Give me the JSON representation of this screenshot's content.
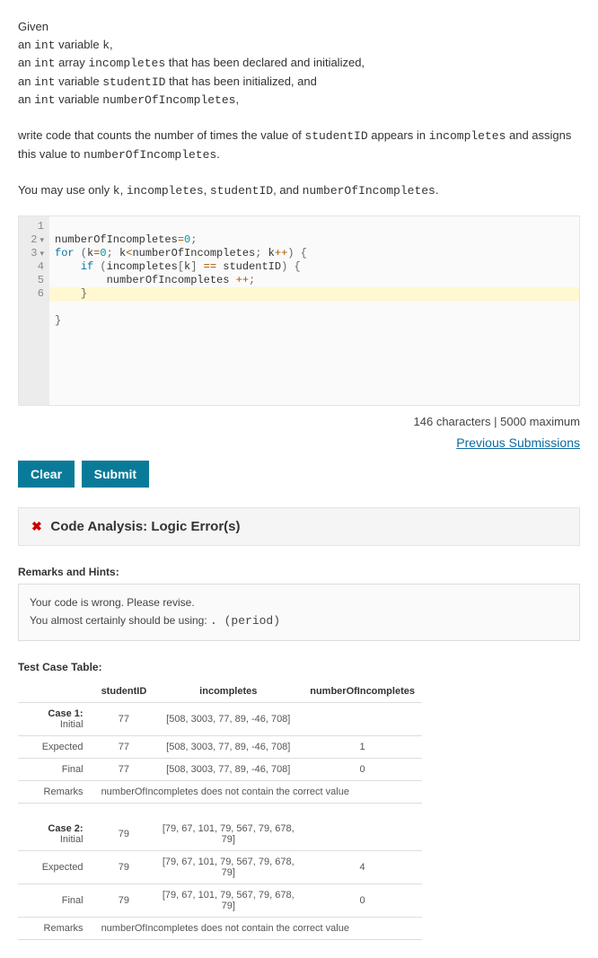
{
  "prompt": {
    "given": "Given",
    "l1a": "an ",
    "l1m": "int",
    "l1b": " variable ",
    "l1v": "k",
    "l1c": ",",
    "l2a": "an ",
    "l2m": "int",
    "l2b": " array ",
    "l2v": "incompletes",
    "l2c": " that has been declared and initialized,",
    "l3a": "an ",
    "l3m": "int",
    "l3b": " variable ",
    "l3v": "studentID",
    "l3c": " that has been initialized, and",
    "l4a": "an ",
    "l4m": "int",
    "l4b": " variable ",
    "l4v": "numberOfIncompletes",
    "l4c": ",",
    "p2a": "write code that counts the number of times the value of ",
    "p2v1": "studentID",
    "p2b": " appears in ",
    "p2v2": "incompletes",
    "p2c": " and assigns this value to ",
    "p2v3": "numberOfIncompletes",
    "p2d": ".",
    "p3a": "You may use only ",
    "p3v1": "k",
    "p3c1": ", ",
    "p3v2": "incompletes",
    "p3c2": ", ",
    "p3v3": "studentID",
    "p3c3": ", and ",
    "p3v4": "numberOfIncompletes",
    "p3d": "."
  },
  "gutter": {
    "l1": "1",
    "l2": "2",
    "l3": "3",
    "l4": "4",
    "l5": "5",
    "l6": "6"
  },
  "code": {
    "l1": "numberOfIncompletes=0;",
    "l2_for": "for",
    "l2_rest": " (k=0; k<numberOfIncompletes; k++) {",
    "l3_if": "if",
    "l3_rest": " (incompletes[k] == studentID) {",
    "l4": "        numberOfIncompletes ++;",
    "l5": "    }",
    "l6": "}"
  },
  "charcount": {
    "chars": "146 characters",
    "sep": "  |  ",
    "max": "5000 maximum"
  },
  "prevsub": "Previous Submissions",
  "buttons": {
    "clear": "Clear",
    "submit": "Submit"
  },
  "analysis": {
    "icon": "✖",
    "title": "Code Analysis: Logic Error(s)"
  },
  "remarks": {
    "heading": "Remarks and Hints:",
    "line1": "Your code is wrong. Please revise.",
    "line2a": "You almost certainly should be using:  ",
    "line2m": ". (period)"
  },
  "testcase": {
    "heading": "Test Case Table:",
    "h1": "studentID",
    "h2": "incompletes",
    "h3": "numberOfIncompletes",
    "c1": {
      "initlbl_a": "Case 1:",
      "initlbl_b": " Initial",
      "init_s": "77",
      "init_i": "[508, 3003, 77, 89, -46, 708]",
      "init_n": "",
      "explbl": "Expected",
      "exp_s": "77",
      "exp_i": "[508, 3003, 77, 89, -46, 708]",
      "exp_n": "1",
      "finlbl": "Final",
      "fin_s": "77",
      "fin_i": "[508, 3003, 77, 89, -46, 708]",
      "fin_n": "0",
      "remlbl": "Remarks",
      "rem": "numberOfIncompletes does not contain the correct value"
    },
    "c2": {
      "initlbl_a": "Case 2:",
      "initlbl_b": " Initial",
      "init_s": "79",
      "init_i": "[79, 67, 101, 79, 567, 79, 678, 79]",
      "init_n": "",
      "explbl": "Expected",
      "exp_s": "79",
      "exp_i": "[79, 67, 101, 79, 567, 79, 678, 79]",
      "exp_n": "4",
      "finlbl": "Final",
      "fin_s": "79",
      "fin_i": "[79, 67, 101, 79, 567, 79, 678, 79]",
      "fin_n": "0",
      "remlbl": "Remarks",
      "rem": "numberOfIncompletes does not contain the correct value"
    }
  }
}
